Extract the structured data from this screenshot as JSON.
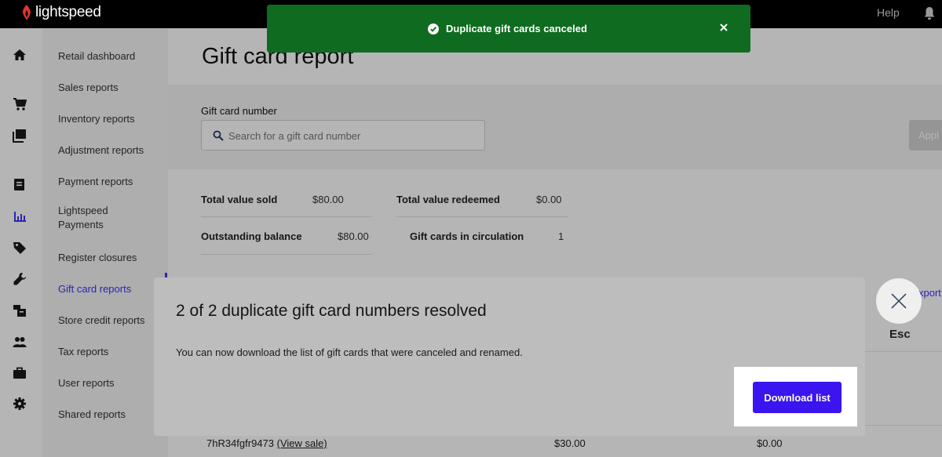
{
  "topbar": {
    "logo_text": "lightspeed",
    "help_label": "Help"
  },
  "rail": {
    "icons": [
      "home-icon",
      "cart-icon",
      "catalog-icon",
      "document-icon",
      "reports-icon",
      "tag-icon",
      "wrench-icon",
      "store-icon",
      "customers-icon",
      "briefcase-icon",
      "gear-icon"
    ]
  },
  "submenu": {
    "items": [
      {
        "label": "Retail dashboard"
      },
      {
        "label": "Sales reports"
      },
      {
        "label": "Inventory reports"
      },
      {
        "label": "Adjustment reports"
      },
      {
        "label": "Payment reports"
      },
      {
        "label": "Lightspeed Payments"
      },
      {
        "label": "Register closures"
      },
      {
        "label": "Gift card reports",
        "active": true
      },
      {
        "label": "Store credit reports"
      },
      {
        "label": "Tax reports"
      },
      {
        "label": "User reports"
      },
      {
        "label": "Shared reports"
      }
    ]
  },
  "page": {
    "title": "Gift card report",
    "filter_label": "Gift card number",
    "search_placeholder": "Search for a gift card number",
    "apply_label": "Appl"
  },
  "stats": {
    "total_value_sold_label": "Total value sold",
    "total_value_sold": "$80.00",
    "total_value_redeemed_label": "Total value redeemed",
    "total_value_redeemed": "$0.00",
    "outstanding_balance_label": "Outstanding balance",
    "outstanding_balance": "$80.00",
    "in_circulation_label": "Gift cards in circulation",
    "in_circulation": "1"
  },
  "table": {
    "export_label": "xport",
    "row": {
      "card_number": "7hR34fgfr9473",
      "view_sale_label": "(View sale)",
      "amount": "$30.00",
      "balance": "$0.00"
    }
  },
  "toast": {
    "message": "Duplicate gift cards canceled",
    "color": "#0f6b1f"
  },
  "modal": {
    "title": "2 of 2 duplicate gift card numbers resolved",
    "body": "You can now download the list of gift cards that were canceled and renamed.",
    "download_label": "Download list",
    "accent": "#3b14ef"
  },
  "esc": {
    "label": "Esc"
  }
}
